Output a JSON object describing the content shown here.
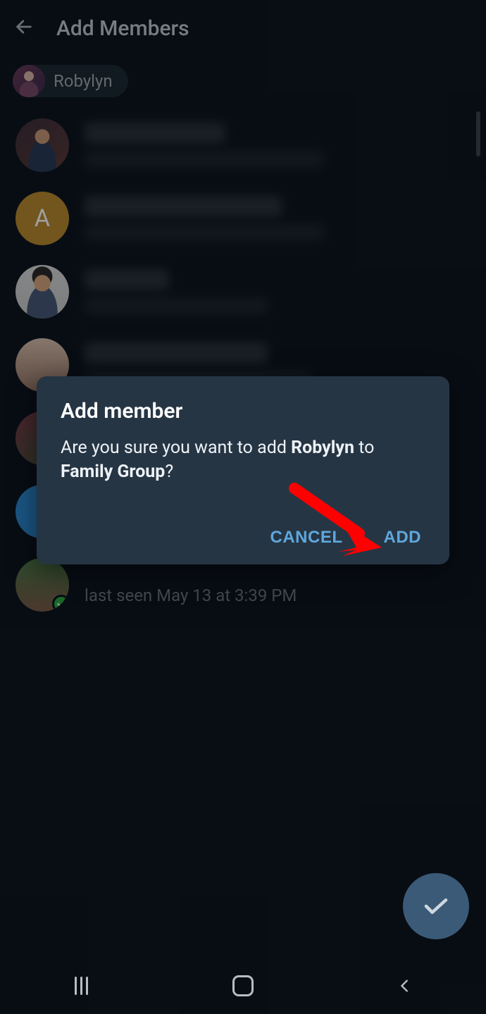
{
  "header": {
    "title": "Add Members"
  },
  "selected_chip": {
    "name": "Robylyn"
  },
  "contacts": [
    {
      "avatar_letter": "",
      "status": ""
    },
    {
      "avatar_letter": "A",
      "status": ""
    },
    {
      "avatar_letter": "",
      "status": ""
    },
    {
      "avatar_letter": "",
      "status": ""
    },
    {
      "avatar_letter": "",
      "status": ""
    },
    {
      "avatar_letter": "",
      "status": ""
    },
    {
      "avatar_letter": "",
      "status": "last seen May 13 at 3:39 PM",
      "verified": true
    }
  ],
  "dialog": {
    "title": "Add member",
    "body_prefix": "Are you sure you want to add ",
    "member": "Robylyn",
    "body_mid": " to ",
    "group": "Family Group",
    "body_suffix": "?",
    "cancel": "CANCEL",
    "confirm": "ADD"
  }
}
